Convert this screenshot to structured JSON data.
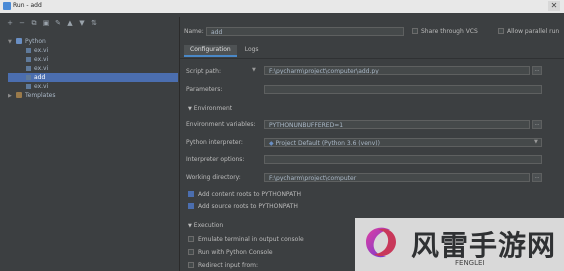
{
  "window": {
    "title": "Run - add"
  },
  "toolbar_icons": [
    "plus-icon",
    "minus-icon",
    "copy-icon",
    "save-icon",
    "wrench-icon",
    "arrow-up-icon",
    "arrow-down-icon",
    "sort-icon"
  ],
  "tree": {
    "python_label": "Python",
    "python_children": [
      "ex.vi",
      "ex.vi",
      "ex.vi",
      "add",
      "ex.vi"
    ],
    "selected_index": 3,
    "templates_label": "Templates"
  },
  "header": {
    "name_label": "Name:",
    "name_value": "add",
    "share_label": "Share through VCS",
    "parallel_label": "Allow parallel run"
  },
  "tabs": [
    "Configuration",
    "Logs"
  ],
  "config": {
    "script_path_label": "Script path:",
    "script_path_value": "F:\\pycharm\\project\\computer\\add.py",
    "parameters_label": "Parameters:",
    "environment_section": "Environment",
    "env_vars_label": "Environment variables:",
    "env_vars_value": "PYTHONUNBUFFERED=1",
    "interpreter_label": "Python interpreter:",
    "interpreter_value": "Project Default (Python 3.6 (venv))",
    "interp_options_label": "Interpreter options:",
    "workdir_label": "Working directory:",
    "workdir_value": "F:\\pycharm\\project\\computer",
    "add_content_roots": "Add content roots to PYTHONPATH",
    "add_source_roots": "Add source roots to PYTHONPATH",
    "execution_section": "Execution",
    "emulate_terminal": "Emulate terminal in output console",
    "run_console": "Run with Python Console",
    "redirect_input": "Redirect input from:"
  },
  "watermark": {
    "text": "风雷手游网",
    "sub": "FENGLEI"
  },
  "colors": {
    "background": "#3c3f41",
    "selection": "#4b6eaf",
    "field": "#45494a",
    "accent": "#4a88c7"
  }
}
